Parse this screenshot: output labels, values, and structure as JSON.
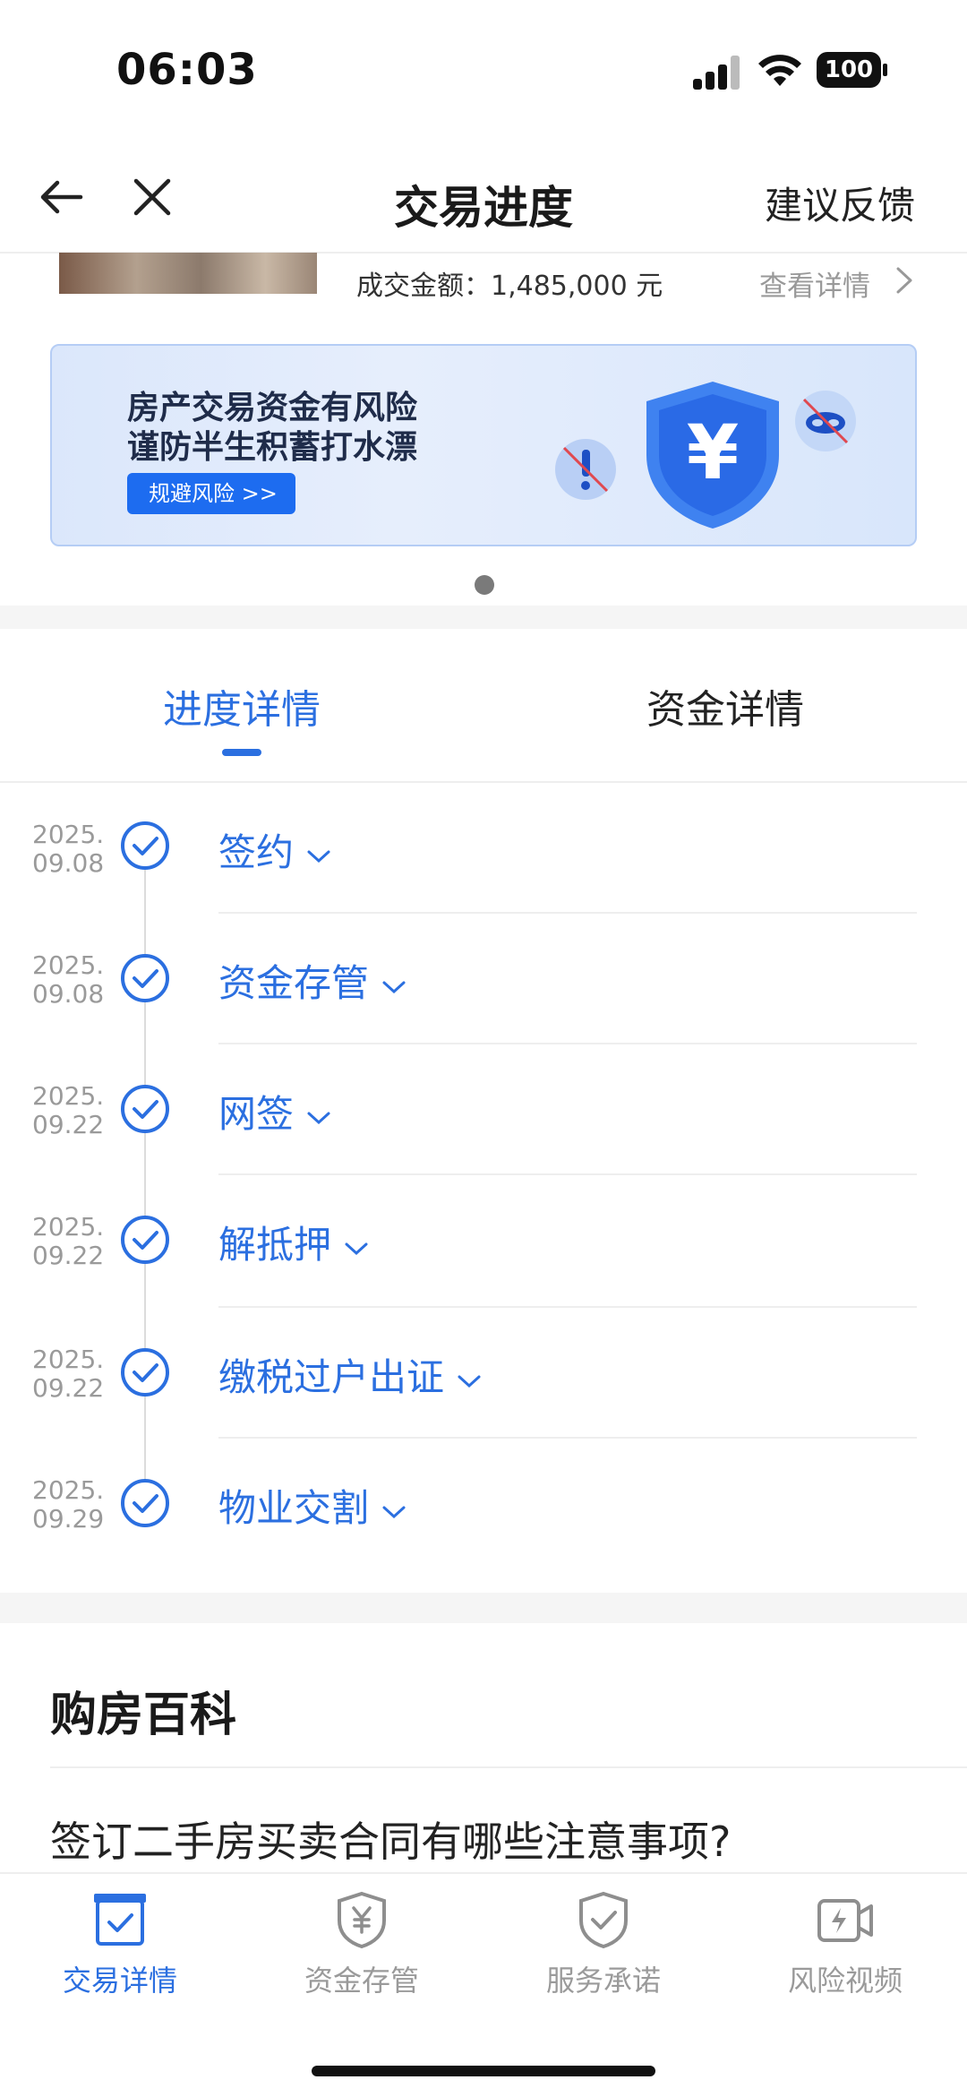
{
  "status_bar": {
    "time": "06:03",
    "battery": "100"
  },
  "nav": {
    "title": "交易进度",
    "feedback": "建议反馈"
  },
  "deal": {
    "amount_text": "成交金额：1,485,000 元",
    "detail_link": "查看详情"
  },
  "banner": {
    "line1": "房产交易资金有风险",
    "line2": "谨防半生积蓄打水漂",
    "button": "规避风险 >>",
    "shield_symbol": "¥"
  },
  "tabs": [
    {
      "label": "进度详情",
      "active": true
    },
    {
      "label": "资金详情",
      "active": false
    }
  ],
  "timeline": [
    {
      "year": "2025.",
      "date": "09.08",
      "label": "签约"
    },
    {
      "year": "2025.",
      "date": "09.08",
      "label": "资金存管"
    },
    {
      "year": "2025.",
      "date": "09.22",
      "label": "网签"
    },
    {
      "year": "2025.",
      "date": "09.22",
      "label": "解抵押"
    },
    {
      "year": "2025.",
      "date": "09.22",
      "label": "缴税过户出证"
    },
    {
      "year": "2025.",
      "date": "09.29",
      "label": "物业交割"
    }
  ],
  "encyclopedia": {
    "title": "购房百科",
    "first_item": "签订二手房买卖合同有哪些注意事项?"
  },
  "tab_bar": [
    {
      "label": "交易详情",
      "icon": "clipboard-check-icon",
      "active": true
    },
    {
      "label": "资金存管",
      "icon": "yuan-shield-icon",
      "active": false
    },
    {
      "label": "服务承诺",
      "icon": "check-shield-icon",
      "active": false
    },
    {
      "label": "风险视频",
      "icon": "video-bolt-icon",
      "active": false
    }
  ],
  "colors": {
    "accent": "#2b6fe0",
    "banner_button": "#1d6cf0",
    "inactive": "#9a9a9a"
  }
}
